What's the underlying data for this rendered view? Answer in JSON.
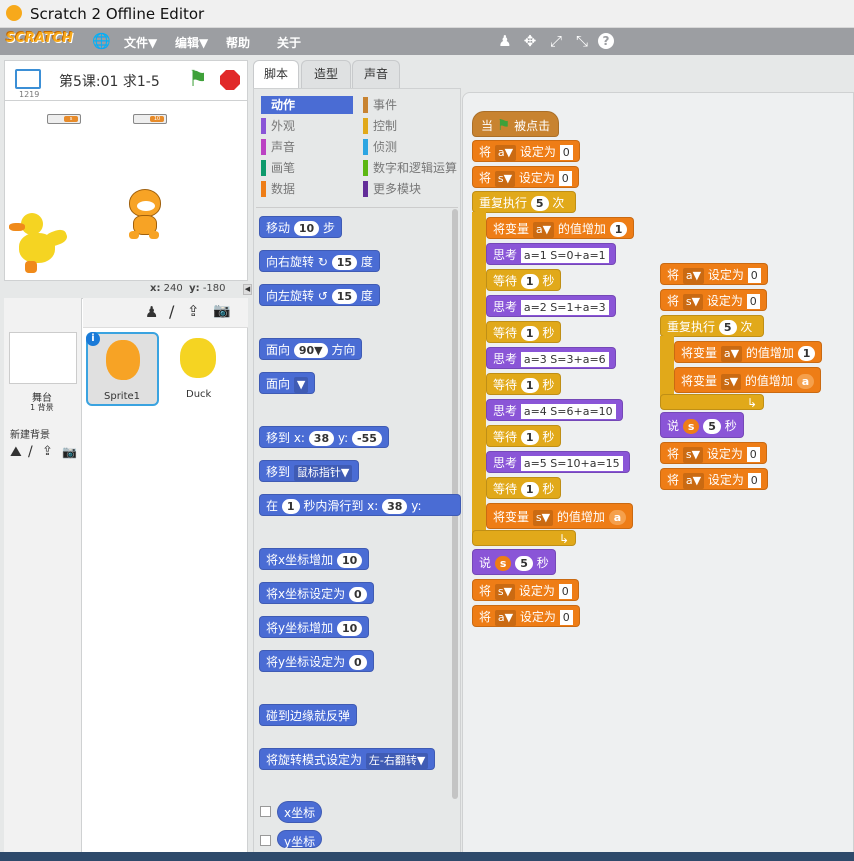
{
  "window": {
    "title": "Scratch 2 Offline Editor"
  },
  "menu": {
    "logo": "SCRATCH",
    "file": "文件▼",
    "edit": "编辑▼",
    "help": "帮助",
    "about": "关于"
  },
  "stage": {
    "project_title": "第5课:01 求1-5",
    "version": "1219",
    "monitor_s": "s",
    "monitor_a": "10",
    "x_label": "x:",
    "x_value": "240",
    "y_label": "y:",
    "y_value": "-180"
  },
  "sprite_pane": {
    "stage_label": "舞台",
    "backdrops": "1 背景",
    "new_backdrop": "新建背景",
    "sprites": [
      "Sprite1",
      "Duck"
    ]
  },
  "tabs": [
    "脚本",
    "造型",
    "声音"
  ],
  "categories": [
    "动作",
    "外观",
    "声音",
    "画笔",
    "数据",
    "事件",
    "控制",
    "侦测",
    "数字和逻辑运算",
    "更多模块"
  ],
  "palette": {
    "move": "移动",
    "move_val": "10",
    "steps": "步",
    "turn_right": "向右旋转",
    "turn_right_val": "15",
    "deg": "度",
    "turn_left": "向左旋转",
    "turn_left_val": "15",
    "point_dir": "面向",
    "point_dir_val": "90▼",
    "dir": "方向",
    "point_to": "面向",
    "goto_xy": "移到 x:",
    "goto_x": "38",
    "goto_y_lbl": "y:",
    "goto_y": "-55",
    "goto": "移到",
    "goto_target": "鼠标指针▼",
    "glide": "在",
    "glide_secs": "1",
    "glide_mid": "秒内滑行到 x:",
    "glide_x": "38",
    "glide_y_lbl": "y:",
    "change_x": "将x坐标增加",
    "change_x_val": "10",
    "set_x": "将x坐标设定为",
    "set_x_val": "0",
    "change_y": "将y坐标增加",
    "change_y_val": "10",
    "set_y": "将y坐标设定为",
    "set_y_val": "0",
    "bounce": "碰到边缘就反弹",
    "rotation": "将旋转模式设定为",
    "rotation_val": "左-右翻转▼",
    "xpos": "x坐标",
    "ypos": "y坐标"
  },
  "script1": {
    "hat_when": "当",
    "hat_clicked": "被点击",
    "set": "将",
    "to": "设定为",
    "var_a": "a▼",
    "var_s": "s▼",
    "zero": "0",
    "repeat": "重复执行",
    "times": "次",
    "five": "5",
    "change": "将变量",
    "by": "的值增加",
    "one": "1",
    "a": "a",
    "think1": "思考",
    "t1": "a=1  S=0+a=1",
    "t2": "a=2  S=1+a=3",
    "t3": "a=3  S=3+a=6",
    "t4": "a=4  S=6+a=10",
    "t5": "a=5  S=10+a=15",
    "wait": "等待",
    "secs": "秒",
    "say": "说",
    "s": "s"
  }
}
